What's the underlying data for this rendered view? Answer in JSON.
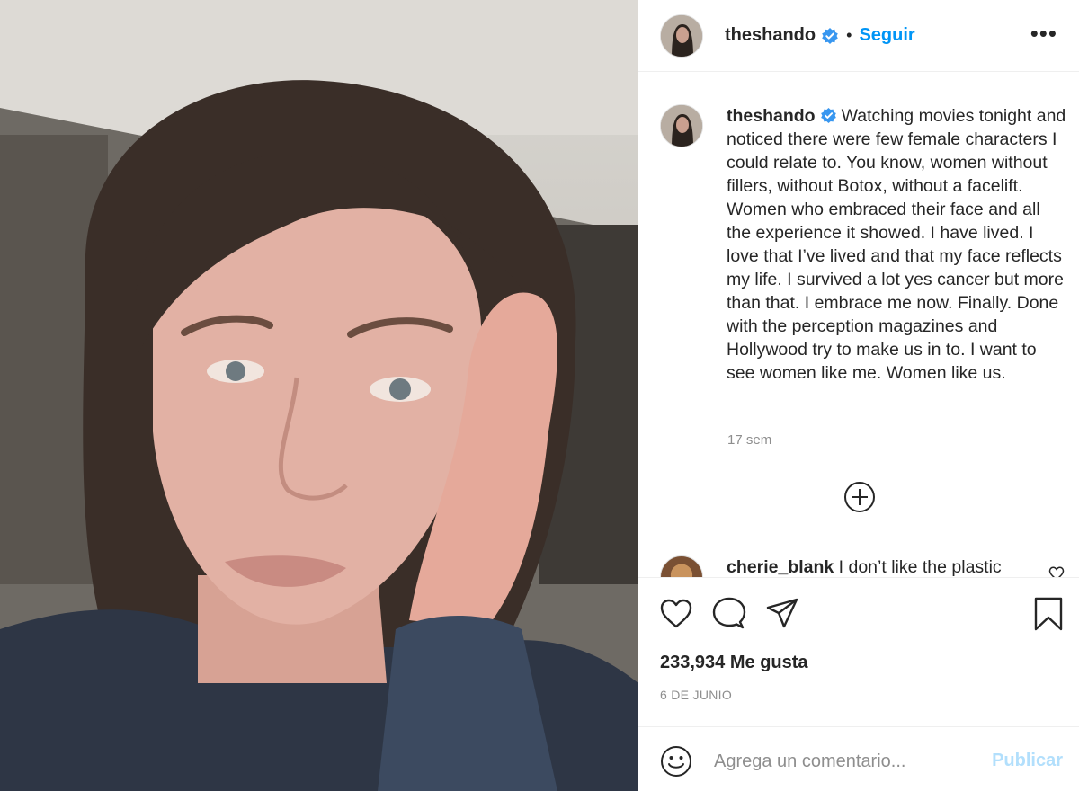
{
  "post": {
    "author": "theshando",
    "follow_label": "Seguir",
    "separator": "•",
    "more_label": "•••",
    "caption": "Watching movies tonight and noticed there were few female characters I could relate to. You know, women without fillers, without Botox, without a facelift. Women who embraced their face and all the experience it showed. I have lived. I love that I’ve lived and that my face reflects my life. I survived a lot yes cancer but more than that. I embrace me now. Finally. Done with the perception magazines and Hollywood try to make us in to. I want to see women like me. Women like us.",
    "caption_age": "17 sem",
    "likes": "233,934 Me gusta",
    "date": "6 DE JUNIO"
  },
  "first_comment": {
    "author": "cherie_blank",
    "text": "I don’t like the plastic"
  },
  "comment_box": {
    "placeholder": "Agrega un comentario...",
    "post_label": "Publicar"
  },
  "colors": {
    "accent": "#0095f6",
    "post_disabled": "#b2dffc",
    "muted": "#8e8e8e",
    "text": "#262626",
    "verified": "#3897f0"
  },
  "icons": [
    "verified-badge-icon",
    "more-options-icon",
    "load-more-icon",
    "heart-icon",
    "comment-icon",
    "share-icon",
    "bookmark-icon",
    "emoji-icon"
  ]
}
